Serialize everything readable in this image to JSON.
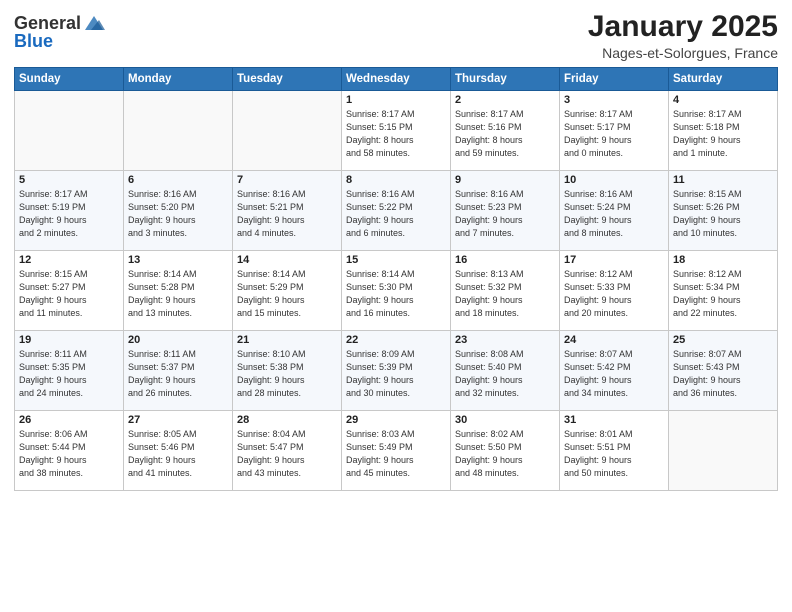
{
  "logo": {
    "general": "General",
    "blue": "Blue"
  },
  "title": "January 2025",
  "location": "Nages-et-Solorgues, France",
  "weekdays": [
    "Sunday",
    "Monday",
    "Tuesday",
    "Wednesday",
    "Thursday",
    "Friday",
    "Saturday"
  ],
  "weeks": [
    [
      {
        "day": "",
        "info": ""
      },
      {
        "day": "",
        "info": ""
      },
      {
        "day": "",
        "info": ""
      },
      {
        "day": "1",
        "info": "Sunrise: 8:17 AM\nSunset: 5:15 PM\nDaylight: 8 hours\nand 58 minutes."
      },
      {
        "day": "2",
        "info": "Sunrise: 8:17 AM\nSunset: 5:16 PM\nDaylight: 8 hours\nand 59 minutes."
      },
      {
        "day": "3",
        "info": "Sunrise: 8:17 AM\nSunset: 5:17 PM\nDaylight: 9 hours\nand 0 minutes."
      },
      {
        "day": "4",
        "info": "Sunrise: 8:17 AM\nSunset: 5:18 PM\nDaylight: 9 hours\nand 1 minute."
      }
    ],
    [
      {
        "day": "5",
        "info": "Sunrise: 8:17 AM\nSunset: 5:19 PM\nDaylight: 9 hours\nand 2 minutes."
      },
      {
        "day": "6",
        "info": "Sunrise: 8:16 AM\nSunset: 5:20 PM\nDaylight: 9 hours\nand 3 minutes."
      },
      {
        "day": "7",
        "info": "Sunrise: 8:16 AM\nSunset: 5:21 PM\nDaylight: 9 hours\nand 4 minutes."
      },
      {
        "day": "8",
        "info": "Sunrise: 8:16 AM\nSunset: 5:22 PM\nDaylight: 9 hours\nand 6 minutes."
      },
      {
        "day": "9",
        "info": "Sunrise: 8:16 AM\nSunset: 5:23 PM\nDaylight: 9 hours\nand 7 minutes."
      },
      {
        "day": "10",
        "info": "Sunrise: 8:16 AM\nSunset: 5:24 PM\nDaylight: 9 hours\nand 8 minutes."
      },
      {
        "day": "11",
        "info": "Sunrise: 8:15 AM\nSunset: 5:26 PM\nDaylight: 9 hours\nand 10 minutes."
      }
    ],
    [
      {
        "day": "12",
        "info": "Sunrise: 8:15 AM\nSunset: 5:27 PM\nDaylight: 9 hours\nand 11 minutes."
      },
      {
        "day": "13",
        "info": "Sunrise: 8:14 AM\nSunset: 5:28 PM\nDaylight: 9 hours\nand 13 minutes."
      },
      {
        "day": "14",
        "info": "Sunrise: 8:14 AM\nSunset: 5:29 PM\nDaylight: 9 hours\nand 15 minutes."
      },
      {
        "day": "15",
        "info": "Sunrise: 8:14 AM\nSunset: 5:30 PM\nDaylight: 9 hours\nand 16 minutes."
      },
      {
        "day": "16",
        "info": "Sunrise: 8:13 AM\nSunset: 5:32 PM\nDaylight: 9 hours\nand 18 minutes."
      },
      {
        "day": "17",
        "info": "Sunrise: 8:12 AM\nSunset: 5:33 PM\nDaylight: 9 hours\nand 20 minutes."
      },
      {
        "day": "18",
        "info": "Sunrise: 8:12 AM\nSunset: 5:34 PM\nDaylight: 9 hours\nand 22 minutes."
      }
    ],
    [
      {
        "day": "19",
        "info": "Sunrise: 8:11 AM\nSunset: 5:35 PM\nDaylight: 9 hours\nand 24 minutes."
      },
      {
        "day": "20",
        "info": "Sunrise: 8:11 AM\nSunset: 5:37 PM\nDaylight: 9 hours\nand 26 minutes."
      },
      {
        "day": "21",
        "info": "Sunrise: 8:10 AM\nSunset: 5:38 PM\nDaylight: 9 hours\nand 28 minutes."
      },
      {
        "day": "22",
        "info": "Sunrise: 8:09 AM\nSunset: 5:39 PM\nDaylight: 9 hours\nand 30 minutes."
      },
      {
        "day": "23",
        "info": "Sunrise: 8:08 AM\nSunset: 5:40 PM\nDaylight: 9 hours\nand 32 minutes."
      },
      {
        "day": "24",
        "info": "Sunrise: 8:07 AM\nSunset: 5:42 PM\nDaylight: 9 hours\nand 34 minutes."
      },
      {
        "day": "25",
        "info": "Sunrise: 8:07 AM\nSunset: 5:43 PM\nDaylight: 9 hours\nand 36 minutes."
      }
    ],
    [
      {
        "day": "26",
        "info": "Sunrise: 8:06 AM\nSunset: 5:44 PM\nDaylight: 9 hours\nand 38 minutes."
      },
      {
        "day": "27",
        "info": "Sunrise: 8:05 AM\nSunset: 5:46 PM\nDaylight: 9 hours\nand 41 minutes."
      },
      {
        "day": "28",
        "info": "Sunrise: 8:04 AM\nSunset: 5:47 PM\nDaylight: 9 hours\nand 43 minutes."
      },
      {
        "day": "29",
        "info": "Sunrise: 8:03 AM\nSunset: 5:49 PM\nDaylight: 9 hours\nand 45 minutes."
      },
      {
        "day": "30",
        "info": "Sunrise: 8:02 AM\nSunset: 5:50 PM\nDaylight: 9 hours\nand 48 minutes."
      },
      {
        "day": "31",
        "info": "Sunrise: 8:01 AM\nSunset: 5:51 PM\nDaylight: 9 hours\nand 50 minutes."
      },
      {
        "day": "",
        "info": ""
      }
    ]
  ]
}
